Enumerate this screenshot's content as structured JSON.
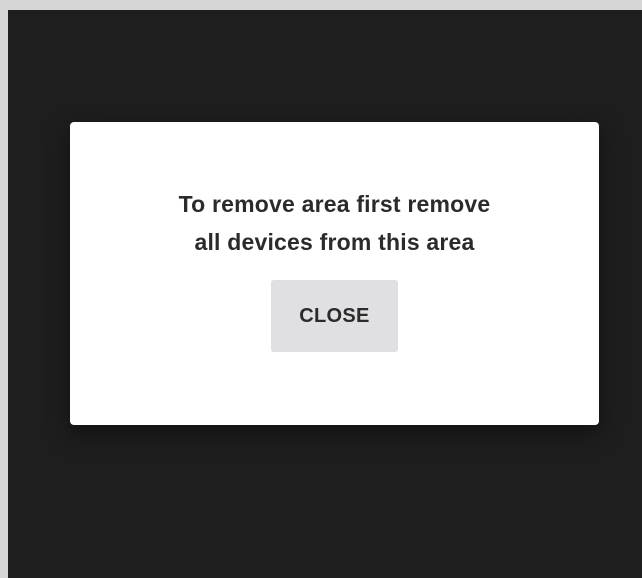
{
  "dialog": {
    "message_line_1": "To remove area first remove",
    "message_line_2": "all devices from this area",
    "close_label": "CLOSE"
  },
  "colors": {
    "outer_background": "#d6d6d6",
    "app_background": "#1e1e1e",
    "dialog_background": "#ffffff",
    "button_background": "#e0e0e2",
    "text": "#2b2b2b"
  }
}
